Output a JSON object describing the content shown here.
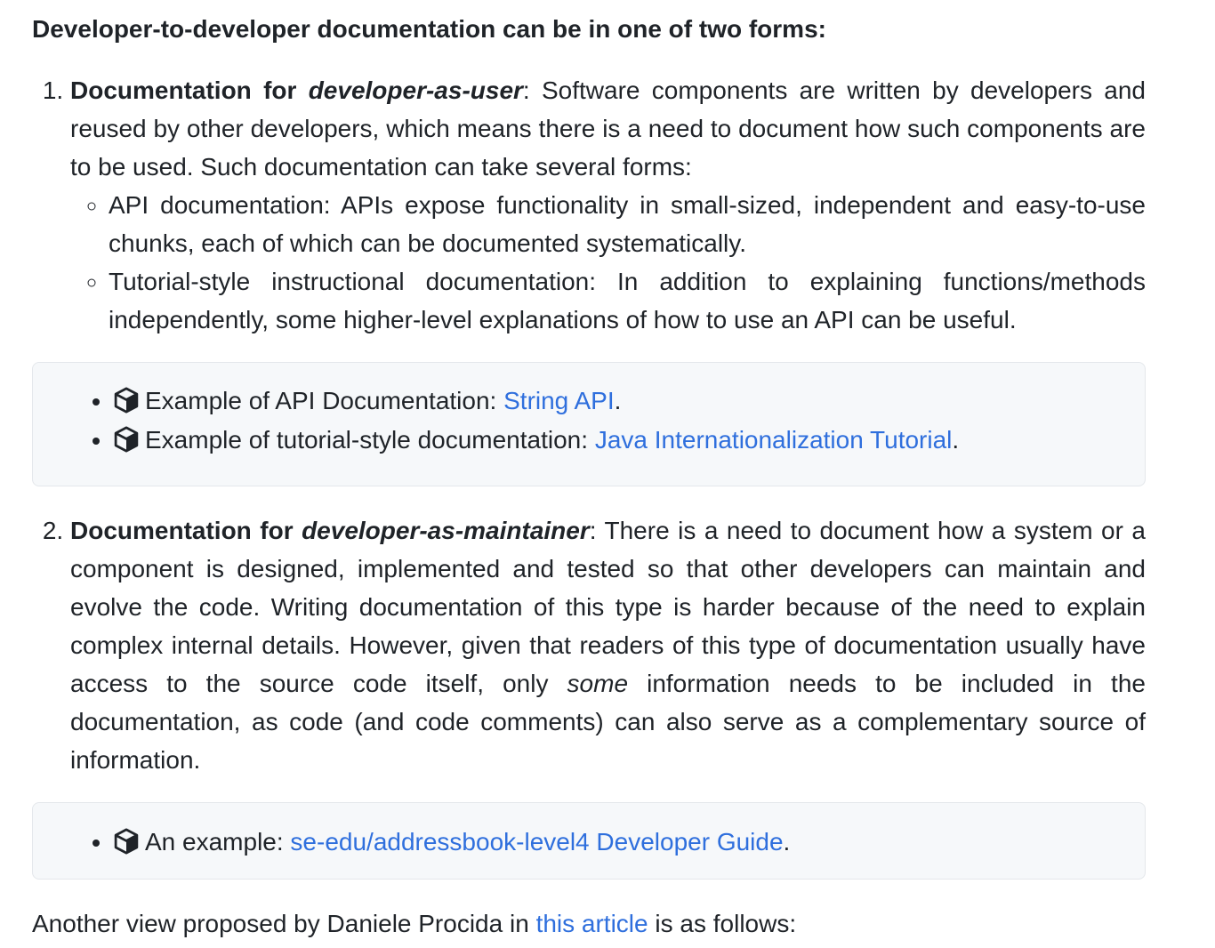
{
  "lead": "Developer-to-developer documentation can be in one of two forms:",
  "item1": {
    "bold_prefix": "Documentation for ",
    "bold_italic": "developer-as-user",
    "text": ": Software components are written by developers and reused by other developers, which means there is a need to document how such components are to be used. Such documentation can take several forms:",
    "subitems": [
      "API documentation: APIs expose functionality in small-sized, independent and easy-to-use chunks, each of which can be documented systematically.",
      "Tutorial-style instructional documentation: In addition to explaining functions/methods independently, some higher-level explanations of how to use an API can be useful."
    ],
    "examples": [
      {
        "icon": "package-icon",
        "text": "Example of API Documentation: ",
        "link": "String API",
        "suffix": "."
      },
      {
        "icon": "package-icon",
        "text": "Example of tutorial-style documentation: ",
        "link": "Java Internationalization Tutorial",
        "suffix": "."
      }
    ]
  },
  "item2": {
    "bold_prefix": "Documentation for ",
    "bold_italic": "developer-as-maintainer",
    "text_a": ": There is a need to document how a system or a component is designed, implemented and tested so that other developers can maintain and evolve the code. Writing documentation of this type is harder because of the need to explain complex internal details. However, given that readers of this type of documentation usually have access to the source code itself, only ",
    "italic": "some",
    "text_b": " information needs to be included in the documentation, as code (and code comments) can also serve as a complementary source of information.",
    "examples": [
      {
        "icon": "package-icon",
        "text": "An example: ",
        "link": "se-edu/addressbook-level4 Developer Guide",
        "suffix": "."
      }
    ]
  },
  "next": {
    "text_a": "Another view proposed by Daniele Procida in ",
    "link": "this article",
    "text_b": " is as follows:"
  },
  "colors": {
    "link": "#2f6fdd",
    "box_bg": "#f6f8fa",
    "text": "#1f2328"
  }
}
